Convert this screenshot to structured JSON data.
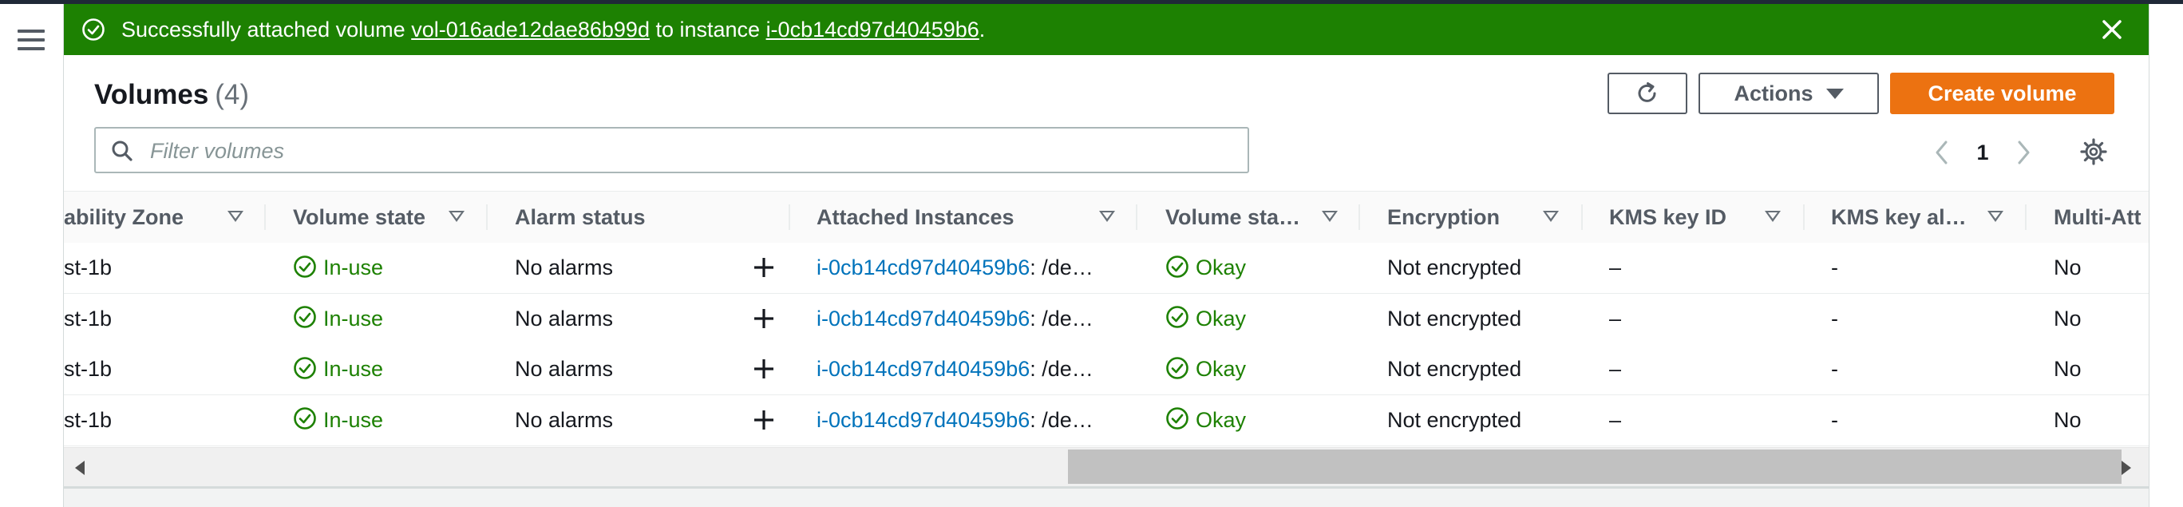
{
  "flash": {
    "prefix": "Successfully attached volume ",
    "volume_id": "vol-016ade12dae86b99d",
    "middle": " to instance ",
    "instance_id": "i-0cb14cd97d40459b6",
    "suffix": ".",
    "color": "#1d8102"
  },
  "header": {
    "title": "Volumes",
    "count": "(4)",
    "refresh_icon": "refresh-icon",
    "actions_label": "Actions",
    "create_label": "Create volume",
    "create_color": "#ec7211"
  },
  "search": {
    "placeholder": "Filter volumes",
    "value": ""
  },
  "pagination": {
    "current_page": "1"
  },
  "table": {
    "columns": [
      "ability Zone",
      "Volume state",
      "Alarm status",
      "Attached Instances",
      "Volume sta…",
      "Encryption",
      "KMS key ID",
      "KMS key al…",
      "Multi-Att"
    ],
    "rows": [
      {
        "zone": "st-1b",
        "state": "In-use",
        "alarm": "No alarms",
        "instance": "i-0cb14cd97d40459b6",
        "device": ": /de…",
        "status": "Okay",
        "encryption": "Not encrypted",
        "kms_id": "–",
        "kms_alias": "-",
        "multi": "No"
      },
      {
        "zone": "st-1b",
        "state": "In-use",
        "alarm": "No alarms",
        "instance": "i-0cb14cd97d40459b6",
        "device": ": /de…",
        "status": "Okay",
        "encryption": "Not encrypted",
        "kms_id": "–",
        "kms_alias": "-",
        "multi": "No"
      },
      {
        "zone": "st-1b",
        "state": "In-use",
        "alarm": "No alarms",
        "instance": "i-0cb14cd97d40459b6",
        "device": ": /de…",
        "status": "Okay",
        "encryption": "Not encrypted",
        "kms_id": "–",
        "kms_alias": "-",
        "multi": "No"
      },
      {
        "zone": "st-1b",
        "state": "In-use",
        "alarm": "No alarms",
        "instance": "i-0cb14cd97d40459b6",
        "device": ": /de…",
        "status": "Okay",
        "encryption": "Not encrypted",
        "kms_id": "–",
        "kms_alias": "-",
        "multi": "No"
      }
    ]
  }
}
